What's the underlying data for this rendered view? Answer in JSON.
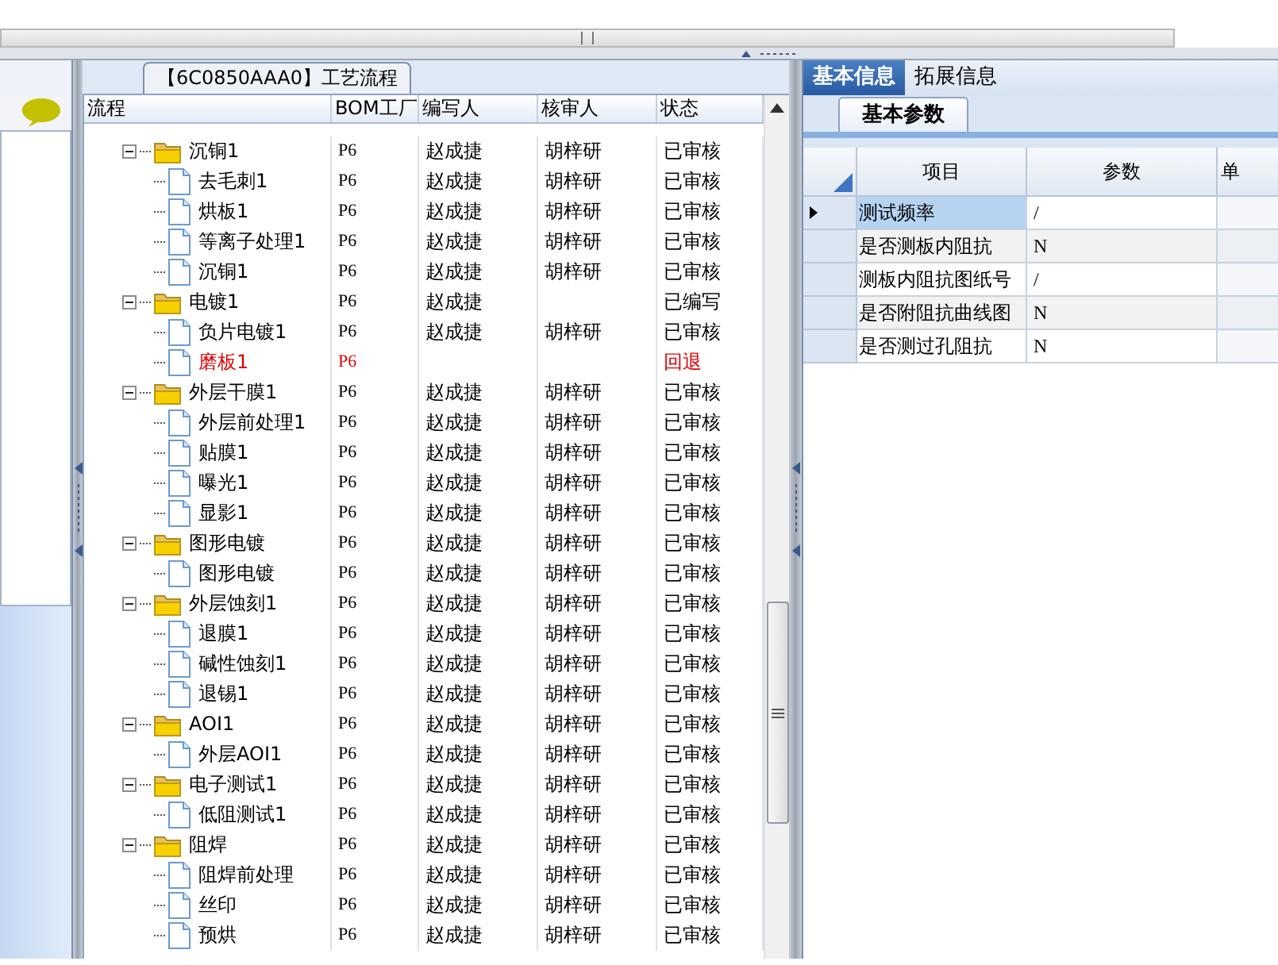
{
  "panel_title": "【6C0850AAA0】工艺流程",
  "tree": {
    "columns": [
      "流程",
      "BOM工厂",
      "编写人",
      "核审人",
      "状态"
    ],
    "rows": [
      {
        "label": "沉铜1",
        "plant": "P6",
        "author": "赵成捷",
        "reviewer": "胡梓研",
        "status": "已审核",
        "returned": false,
        "expanded": true,
        "children": [
          {
            "label": "去毛刺1",
            "plant": "P6",
            "author": "赵成捷",
            "reviewer": "胡梓研",
            "status": "已审核",
            "returned": false
          },
          {
            "label": "烘板1",
            "plant": "P6",
            "author": "赵成捷",
            "reviewer": "胡梓研",
            "status": "已审核",
            "returned": false
          },
          {
            "label": "等离子处理1",
            "plant": "P6",
            "author": "赵成捷",
            "reviewer": "胡梓研",
            "status": "已审核",
            "returned": false
          },
          {
            "label": "沉铜1",
            "plant": "P6",
            "author": "赵成捷",
            "reviewer": "胡梓研",
            "status": "已审核",
            "returned": false
          }
        ]
      },
      {
        "label": "电镀1",
        "plant": "P6",
        "author": "赵成捷",
        "status": "已编写",
        "returned": false,
        "expanded": true,
        "children": [
          {
            "label": "负片电镀1",
            "plant": "P6",
            "author": "赵成捷",
            "reviewer": "胡梓研",
            "status": "已审核",
            "returned": false
          },
          {
            "label": "磨板1",
            "plant": "P6",
            "status": "回退",
            "returned": true
          }
        ]
      },
      {
        "label": "外层干膜1",
        "plant": "P6",
        "author": "赵成捷",
        "reviewer": "胡梓研",
        "status": "已审核",
        "returned": false,
        "expanded": true,
        "children": [
          {
            "label": "外层前处理1",
            "plant": "P6",
            "author": "赵成捷",
            "reviewer": "胡梓研",
            "status": "已审核",
            "returned": false
          },
          {
            "label": "贴膜1",
            "plant": "P6",
            "author": "赵成捷",
            "reviewer": "胡梓研",
            "status": "已审核",
            "returned": false
          },
          {
            "label": "曝光1",
            "plant": "P6",
            "author": "赵成捷",
            "reviewer": "胡梓研",
            "status": "已审核",
            "returned": false
          },
          {
            "label": "显影1",
            "plant": "P6",
            "author": "赵成捷",
            "reviewer": "胡梓研",
            "status": "已审核",
            "returned": false
          }
        ]
      },
      {
        "label": "图形电镀",
        "plant": "P6",
        "author": "赵成捷",
        "reviewer": "胡梓研",
        "status": "已审核",
        "returned": false,
        "expanded": true,
        "children": [
          {
            "label": "图形电镀",
            "plant": "P6",
            "author": "赵成捷",
            "reviewer": "胡梓研",
            "status": "已审核",
            "returned": false
          }
        ]
      },
      {
        "label": "外层蚀刻1",
        "plant": "P6",
        "author": "赵成捷",
        "reviewer": "胡梓研",
        "status": "已审核",
        "returned": false,
        "expanded": true,
        "children": [
          {
            "label": "退膜1",
            "plant": "P6",
            "author": "赵成捷",
            "reviewer": "胡梓研",
            "status": "已审核",
            "returned": false
          },
          {
            "label": "碱性蚀刻1",
            "plant": "P6",
            "author": "赵成捷",
            "reviewer": "胡梓研",
            "status": "已审核",
            "returned": false
          },
          {
            "label": "退锡1",
            "plant": "P6",
            "author": "赵成捷",
            "reviewer": "胡梓研",
            "status": "已审核",
            "returned": false
          }
        ]
      },
      {
        "label": "AOI1",
        "plant": "P6",
        "author": "赵成捷",
        "reviewer": "胡梓研",
        "status": "已审核",
        "returned": false,
        "expanded": true,
        "children": [
          {
            "label": "外层AOI1",
            "plant": "P6",
            "author": "赵成捷",
            "reviewer": "胡梓研",
            "status": "已审核",
            "returned": false
          }
        ]
      },
      {
        "label": "电子测试1",
        "plant": "P6",
        "author": "赵成捷",
        "reviewer": "胡梓研",
        "status": "已审核",
        "returned": false,
        "expanded": true,
        "children": [
          {
            "label": "低阻测试1",
            "plant": "P6",
            "author": "赵成捷",
            "reviewer": "胡梓研",
            "status": "已审核",
            "returned": false
          }
        ]
      },
      {
        "label": "阻焊",
        "plant": "P6",
        "author": "赵成捷",
        "reviewer": "胡梓研",
        "status": "已审核",
        "returned": false,
        "expanded": true,
        "children": [
          {
            "label": "阻焊前处理",
            "plant": "P6",
            "author": "赵成捷",
            "reviewer": "胡梓研",
            "status": "已审核",
            "returned": false
          },
          {
            "label": "丝印",
            "plant": "P6",
            "author": "赵成捷",
            "reviewer": "胡梓研",
            "status": "已审核",
            "returned": false
          },
          {
            "label": "预烘",
            "plant": "P6",
            "author": "赵成捷",
            "reviewer": "胡梓研",
            "status": "已审核",
            "returned": false
          }
        ]
      }
    ]
  },
  "tabs": [
    {
      "label": "基本信息",
      "selected": true
    },
    {
      "label": "拓展信息",
      "selected": false
    }
  ],
  "subtabs": [
    {
      "label": "基本参数",
      "selected": true
    }
  ],
  "params": {
    "columns": [
      "项目",
      "参数",
      "单"
    ],
    "rows": [
      {
        "item": "测试频率",
        "value": "/",
        "selected": true
      },
      {
        "item": "是否测板内阻抗",
        "value": "N",
        "selected": false
      },
      {
        "item": "测板内阻抗图纸号",
        "value": "/",
        "selected": false
      },
      {
        "item": "是否附阻抗曲线图",
        "value": "N",
        "selected": false
      },
      {
        "item": "是否测过孔阻抗",
        "value": "N",
        "selected": false
      }
    ]
  }
}
